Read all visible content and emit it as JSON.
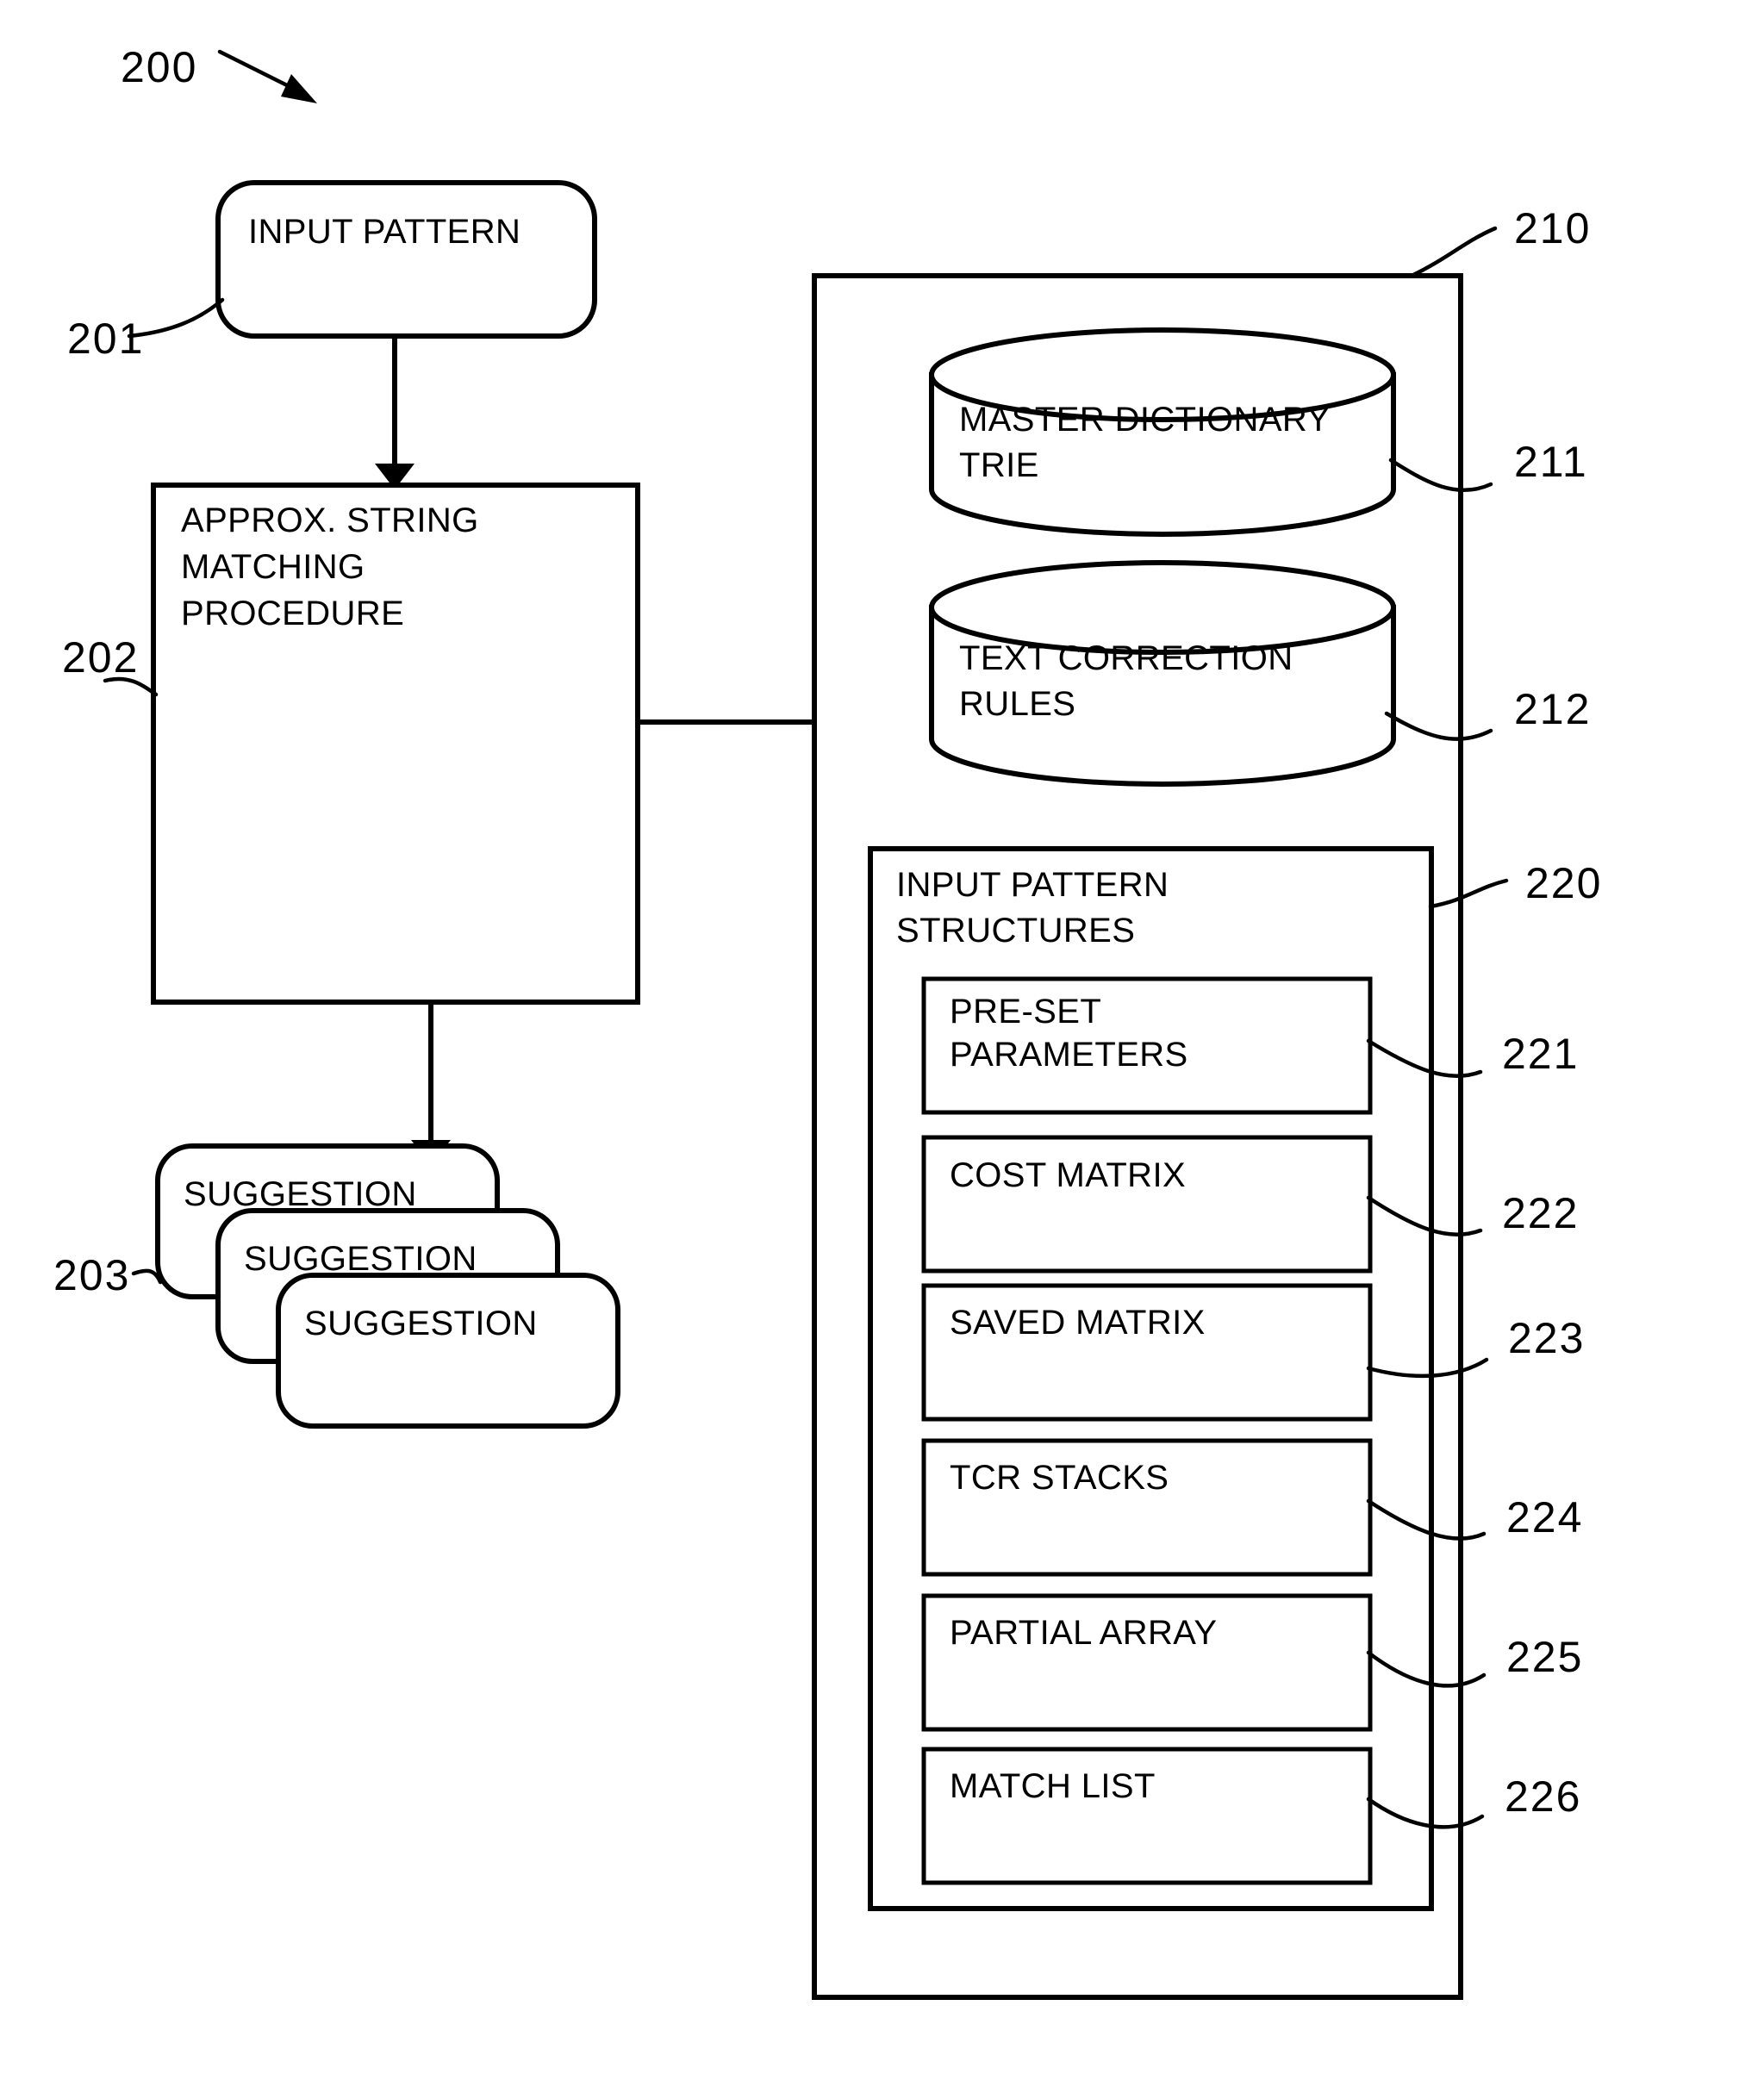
{
  "figure": {
    "number": "200",
    "title_visible": false
  },
  "nodes": {
    "input_pattern": {
      "label": "INPUT PATTERN",
      "ref": "201",
      "shape": "rounded-rectangle"
    },
    "matching_procedure": {
      "label_lines": [
        "APPROX. STRING",
        "MATCHING",
        "PROCEDURE"
      ],
      "ref": "202",
      "shape": "rectangle"
    },
    "suggestions": {
      "ref": "203",
      "shape": "stacked-rounded-rectangles",
      "items": [
        {
          "label": "SUGGESTION"
        },
        {
          "label": "SUGGESTION"
        },
        {
          "label": "SUGGESTION"
        }
      ]
    },
    "storage_container": {
      "ref": "210",
      "shape": "rectangle"
    },
    "master_dictionary_trie": {
      "label_lines": [
        "MASTER DICTIONARY",
        "TRIE"
      ],
      "ref": "211",
      "shape": "cylinder"
    },
    "text_correction_rules": {
      "label_lines": [
        "TEXT CORRECTION",
        "RULES"
      ],
      "ref": "212",
      "shape": "cylinder"
    },
    "input_pattern_structures": {
      "label_lines": [
        "INPUT PATTERN",
        "STRUCTURES"
      ],
      "ref": "220",
      "shape": "rectangle",
      "children": [
        {
          "label": "PRE-SET PARAMETERS",
          "label_lines": [
            "PRE-SET",
            "PARAMETERS"
          ],
          "ref": "221"
        },
        {
          "label": "COST MATRIX",
          "label_lines": [
            "COST MATRIX"
          ],
          "ref": "222"
        },
        {
          "label": "SAVED MATRIX",
          "label_lines": [
            "SAVED MATRIX"
          ],
          "ref": "223"
        },
        {
          "label": "TCR STACKS",
          "label_lines": [
            "TCR STACKS"
          ],
          "ref": "224"
        },
        {
          "label": "PARTIAL ARRAY",
          "label_lines": [
            "PARTIAL ARRAY"
          ],
          "ref": "225"
        },
        {
          "label": "MATCH LIST",
          "label_lines": [
            "MATCH LIST"
          ],
          "ref": "226"
        }
      ]
    }
  },
  "colors": {
    "ink": "#000000",
    "paper": "#ffffff"
  }
}
